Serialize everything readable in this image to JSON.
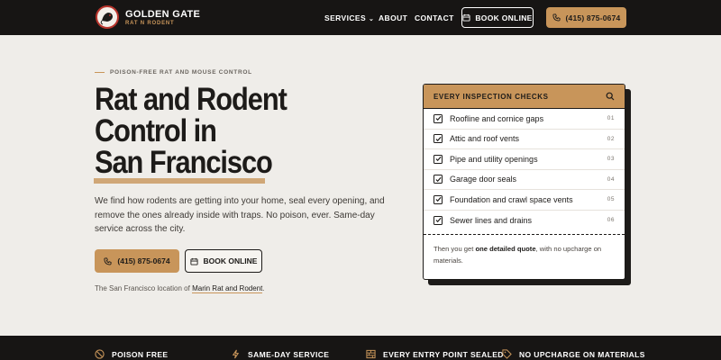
{
  "brand": {
    "name": "GOLDEN GATE",
    "tagline": "RAT N RODENT"
  },
  "nav": {
    "items": [
      {
        "label": "SERVICES",
        "has_dropdown": true
      },
      {
        "label": "ABOUT"
      },
      {
        "label": "CONTACT"
      }
    ]
  },
  "header": {
    "book_label": "BOOK ONLINE",
    "phone_label": "(415) 875-0674"
  },
  "hero": {
    "eyebrow": "POISON-FREE RAT AND MOUSE CONTROL",
    "title_lines": [
      "Rat and Rodent",
      "Control in",
      "San Francisco"
    ],
    "description": "We find how rodents are getting into your home, seal every opening, and remove the ones already inside with traps. No poison, ever. Same-day service across the city.",
    "phone_button": "(415) 875-0674",
    "book_button": "BOOK ONLINE",
    "location_prefix": "The San Francisco location of",
    "location_link": "Marin Rat and Rodent",
    "location_suffix": "."
  },
  "inspection_card": {
    "title": "EVERY INSPECTION CHECKS",
    "items": [
      {
        "label": "Roofline and cornice gaps",
        "num": "01"
      },
      {
        "label": "Attic and roof vents",
        "num": "02"
      },
      {
        "label": "Pipe and utility openings",
        "num": "03"
      },
      {
        "label": "Garage door seals",
        "num": "04"
      },
      {
        "label": "Foundation and crawl space vents",
        "num": "05"
      },
      {
        "label": "Sewer lines and drains",
        "num": "06"
      }
    ],
    "footer_prefix": "Then you get",
    "footer_bold": "one detailed quote",
    "footer_suffix": ", with no upcharge on materials."
  },
  "features": [
    {
      "label": "POISON FREE",
      "icon": "no-poison-icon"
    },
    {
      "label": "SAME-DAY SERVICE",
      "icon": "lightning-icon"
    },
    {
      "label": "EVERY ENTRY POINT SEALED",
      "icon": "brick-wall-icon"
    },
    {
      "label": "NO UPCHARGE ON MATERIALS",
      "icon": "tag-icon"
    }
  ],
  "colors": {
    "accent": "#c8955a",
    "dark": "#171514",
    "background": "#efede9",
    "logo_red": "#b8342c"
  }
}
